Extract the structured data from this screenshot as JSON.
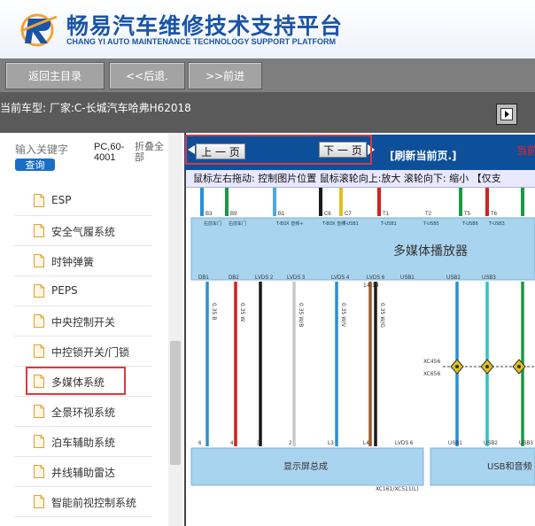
{
  "header": {
    "title_cn": "畅易汽车维修技术支持平台",
    "title_en": "CHANG YI AUTO MAINTENANCE TECHNOLOGY SUPPORT PLATFORM"
  },
  "nav": {
    "home": "返回主目录",
    "back": "<<后退.",
    "forward": ">>前进"
  },
  "vehicle": {
    "text": "当前车型:  厂家:C-长城汽车哈弗H62018"
  },
  "sidebar": {
    "search_placeholder": "输入关键字",
    "search_button": "查询",
    "pc_text": "PC,60-4001",
    "collapse": "折叠全部",
    "items": [
      {
        "label": "ESP"
      },
      {
        "label": "安全气履系统"
      },
      {
        "label": "时钟弹簧"
      },
      {
        "label": "PEPS"
      },
      {
        "label": "中央控制开关"
      },
      {
        "label": "中控锁开关/门锁"
      },
      {
        "label": "多媒体系统"
      },
      {
        "label": "全景环视系统"
      },
      {
        "label": "泊车辅助系统"
      },
      {
        "label": "并线辅助雷达"
      },
      {
        "label": "智能前视控制系统"
      }
    ]
  },
  "pager": {
    "prev": "上 一 页",
    "next": "下 一 页",
    "refresh": "[刷新当前页.]",
    "current": "当前"
  },
  "hint": "鼠标左右拖动: 控制图片位置  鼠标滚轮向上:放大  滚轮向下: 缩小 【仅支",
  "diagram": {
    "main_label": "多媒体播放器",
    "display_label": "显示屏总成",
    "usb_label": "USB和音频",
    "connector_top": [
      "B3",
      "B9",
      "B1",
      "C6",
      "C7",
      "T1",
      "T2",
      "T5",
      "T6"
    ],
    "top_small": [
      "右前车门\n扬声器+",
      "右前车门\n扬声器-",
      "T-BOX 音频+",
      "T-BOX 音频-",
      "T-USB1",
      "T-USB1",
      "T-USB5",
      "T-USB6",
      "T-USB3"
    ],
    "pins_top": [
      "DB1",
      "DB2",
      "LVDS 2",
      "LVDS 3",
      "LVDS 4",
      "LVDS 6",
      "USB1",
      "USB2",
      "USB3"
    ],
    "pin_nums": [
      "14",
      "14"
    ],
    "splice": [
      "XC456",
      "XC656"
    ],
    "wire_labels": [
      "0.35 B",
      "0.35 W",
      "0.35 W/B",
      "0.35 W/V",
      "0.35 W/G"
    ],
    "bottom_pins": [
      "6",
      "4",
      "3",
      "2",
      "L3",
      "L4",
      "LVDS 6",
      "USB1",
      "USB2",
      "USB3"
    ],
    "bottom_conn": "XC161/XC511(L)",
    "colors": {
      "primary": "#0e4f9a",
      "header_blue": "#1a54a7",
      "highlight": "#d9393f"
    }
  }
}
